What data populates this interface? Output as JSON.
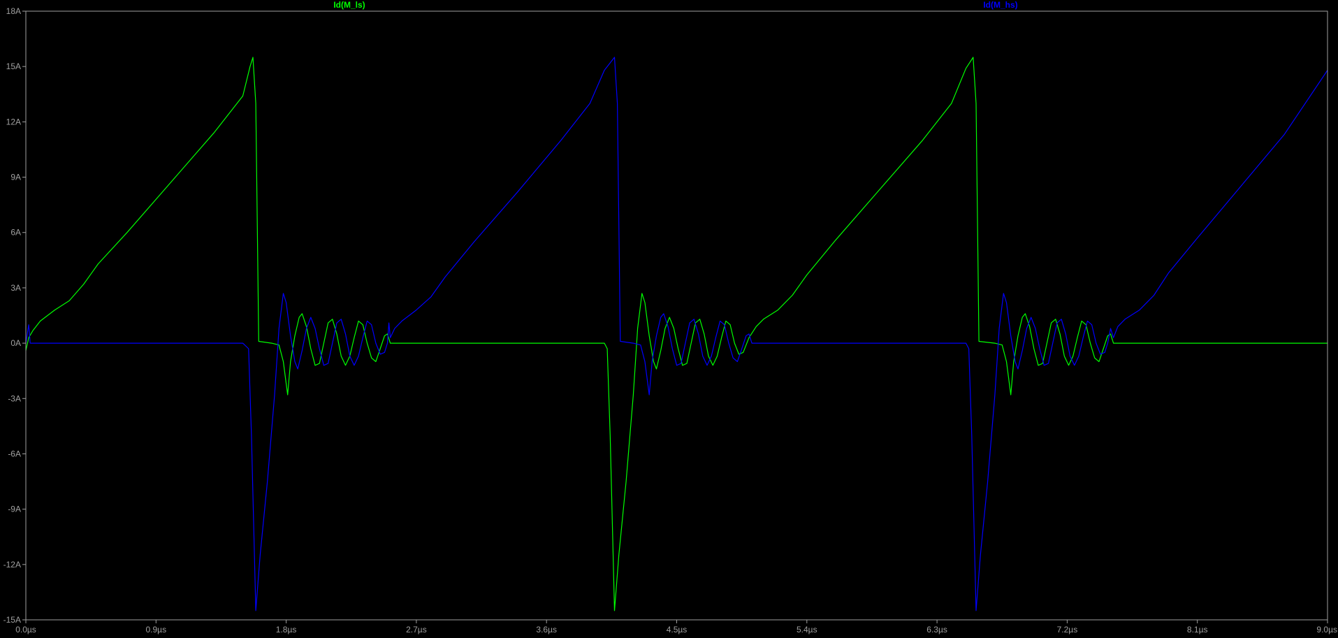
{
  "chart_data": {
    "type": "line",
    "xlabel": "",
    "ylabel": "",
    "xlim": [
      0,
      9.0
    ],
    "ylim": [
      -15,
      18
    ],
    "x_unit": "µs",
    "y_unit": "A",
    "x_ticks": [
      0.0,
      0.9,
      1.8,
      2.7,
      3.6,
      4.5,
      5.4,
      6.3,
      7.2,
      8.1,
      9.0
    ],
    "y_ticks": [
      -15,
      -12,
      -9,
      -6,
      -3,
      0,
      3,
      6,
      9,
      12,
      15,
      18
    ],
    "x_tick_labels": [
      "0.0µs",
      "0.9µs",
      "1.8µs",
      "2.7µs",
      "3.6µs",
      "4.5µs",
      "5.4µs",
      "6.3µs",
      "7.2µs",
      "8.1µs",
      "9.0µs"
    ],
    "y_tick_labels": [
      "-15A",
      "-12A",
      "-9A",
      "-6A",
      "-3A",
      "0A",
      "3A",
      "6A",
      "9A",
      "12A",
      "15A",
      "18A"
    ],
    "grid": false,
    "legend_position": "top",
    "background": "#000000",
    "axis_color": "#a0a0a0",
    "series": [
      {
        "name": "Id(M_ls)",
        "color": "#00ff00",
        "points": [
          [
            0.0,
            -0.4
          ],
          [
            0.02,
            0.3
          ],
          [
            0.05,
            0.7
          ],
          [
            0.1,
            1.2
          ],
          [
            0.2,
            1.8
          ],
          [
            0.3,
            2.3
          ],
          [
            0.4,
            3.2
          ],
          [
            0.5,
            4.3
          ],
          [
            0.7,
            6.0
          ],
          [
            1.0,
            8.7
          ],
          [
            1.3,
            11.4
          ],
          [
            1.5,
            13.4
          ],
          [
            1.55,
            15.0
          ],
          [
            1.57,
            15.5
          ],
          [
            1.59,
            13.0
          ],
          [
            1.61,
            0.1
          ],
          [
            1.7,
            0.0
          ],
          [
            1.75,
            -0.1
          ],
          [
            1.78,
            -1.0
          ],
          [
            1.81,
            -2.8
          ],
          [
            1.83,
            -1.0
          ],
          [
            1.86,
            0.4
          ],
          [
            1.89,
            1.4
          ],
          [
            1.91,
            1.6
          ],
          [
            1.94,
            0.9
          ],
          [
            1.97,
            -0.3
          ],
          [
            2.0,
            -1.2
          ],
          [
            2.03,
            -1.1
          ],
          [
            2.06,
            0.0
          ],
          [
            2.09,
            1.1
          ],
          [
            2.12,
            1.3
          ],
          [
            2.15,
            0.5
          ],
          [
            2.18,
            -0.7
          ],
          [
            2.21,
            -1.2
          ],
          [
            2.24,
            -0.7
          ],
          [
            2.27,
            0.3
          ],
          [
            2.3,
            1.2
          ],
          [
            2.33,
            1.0
          ],
          [
            2.36,
            0.0
          ],
          [
            2.39,
            -0.8
          ],
          [
            2.42,
            -1.0
          ],
          [
            2.45,
            -0.3
          ],
          [
            2.48,
            0.4
          ],
          [
            2.5,
            0.5
          ],
          [
            2.52,
            0.0
          ],
          [
            2.55,
            0.0
          ],
          [
            4.0,
            0.0
          ],
          [
            4.02,
            -0.3
          ],
          [
            4.04,
            -5.0
          ],
          [
            4.07,
            -14.5
          ],
          [
            4.1,
            -11.5
          ],
          [
            4.15,
            -7.5
          ],
          [
            4.2,
            -2.8
          ],
          [
            4.23,
            0.8
          ],
          [
            4.26,
            2.7
          ],
          [
            4.28,
            2.2
          ],
          [
            4.31,
            0.4
          ],
          [
            4.34,
            -1.0
          ],
          [
            4.36,
            -1.4
          ],
          [
            4.39,
            -0.4
          ],
          [
            4.42,
            0.8
          ],
          [
            4.45,
            1.4
          ],
          [
            4.48,
            0.8
          ],
          [
            4.51,
            -0.3
          ],
          [
            4.54,
            -1.2
          ],
          [
            4.57,
            -1.1
          ],
          [
            4.6,
            0.0
          ],
          [
            4.63,
            1.1
          ],
          [
            4.66,
            1.3
          ],
          [
            4.69,
            0.5
          ],
          [
            4.72,
            -0.7
          ],
          [
            4.75,
            -1.2
          ],
          [
            4.78,
            -0.7
          ],
          [
            4.81,
            0.3
          ],
          [
            4.84,
            1.2
          ],
          [
            4.87,
            1.0
          ],
          [
            4.9,
            0.0
          ],
          [
            4.93,
            -0.6
          ],
          [
            4.96,
            -0.5
          ],
          [
            5.0,
            0.3
          ],
          [
            5.05,
            0.9
          ],
          [
            5.1,
            1.3
          ],
          [
            5.2,
            1.8
          ],
          [
            5.3,
            2.6
          ],
          [
            5.4,
            3.7
          ],
          [
            5.6,
            5.6
          ],
          [
            5.9,
            8.3
          ],
          [
            6.2,
            11.0
          ],
          [
            6.4,
            13.0
          ],
          [
            6.5,
            14.9
          ],
          [
            6.55,
            15.5
          ],
          [
            6.57,
            13.0
          ],
          [
            6.59,
            0.1
          ],
          [
            6.7,
            0.0
          ],
          [
            6.75,
            -0.1
          ],
          [
            6.78,
            -1.0
          ],
          [
            6.81,
            -2.8
          ],
          [
            6.83,
            -1.0
          ],
          [
            6.86,
            0.4
          ],
          [
            6.89,
            1.4
          ],
          [
            6.91,
            1.6
          ],
          [
            6.94,
            0.9
          ],
          [
            6.97,
            -0.3
          ],
          [
            7.0,
            -1.2
          ],
          [
            7.03,
            -1.1
          ],
          [
            7.06,
            0.0
          ],
          [
            7.09,
            1.1
          ],
          [
            7.12,
            1.3
          ],
          [
            7.15,
            0.5
          ],
          [
            7.18,
            -0.7
          ],
          [
            7.21,
            -1.2
          ],
          [
            7.24,
            -0.7
          ],
          [
            7.27,
            0.3
          ],
          [
            7.3,
            1.2
          ],
          [
            7.33,
            1.0
          ],
          [
            7.36,
            0.0
          ],
          [
            7.39,
            -0.8
          ],
          [
            7.42,
            -1.0
          ],
          [
            7.45,
            -0.3
          ],
          [
            7.48,
            0.4
          ],
          [
            7.5,
            0.5
          ],
          [
            7.52,
            0.0
          ],
          [
            7.55,
            0.0
          ],
          [
            9.0,
            0.0
          ]
        ]
      },
      {
        "name": "Id(M_hs)",
        "color": "#0000ff",
        "points": [
          [
            0.0,
            0.0
          ],
          [
            0.02,
            1.0
          ],
          [
            0.03,
            0.0
          ],
          [
            1.5,
            0.0
          ],
          [
            1.54,
            -0.3
          ],
          [
            1.56,
            -5.0
          ],
          [
            1.59,
            -14.5
          ],
          [
            1.62,
            -11.5
          ],
          [
            1.67,
            -7.5
          ],
          [
            1.72,
            -2.8
          ],
          [
            1.75,
            0.8
          ],
          [
            1.78,
            2.7
          ],
          [
            1.8,
            2.2
          ],
          [
            1.83,
            0.4
          ],
          [
            1.86,
            -1.0
          ],
          [
            1.88,
            -1.4
          ],
          [
            1.91,
            -0.4
          ],
          [
            1.94,
            0.8
          ],
          [
            1.97,
            1.4
          ],
          [
            2.0,
            0.8
          ],
          [
            2.03,
            -0.3
          ],
          [
            2.06,
            -1.2
          ],
          [
            2.09,
            -1.1
          ],
          [
            2.12,
            0.0
          ],
          [
            2.15,
            1.1
          ],
          [
            2.18,
            1.3
          ],
          [
            2.21,
            0.5
          ],
          [
            2.24,
            -0.7
          ],
          [
            2.27,
            -1.2
          ],
          [
            2.3,
            -0.7
          ],
          [
            2.33,
            0.3
          ],
          [
            2.36,
            1.2
          ],
          [
            2.39,
            1.0
          ],
          [
            2.42,
            0.0
          ],
          [
            2.45,
            -0.6
          ],
          [
            2.48,
            -0.5
          ],
          [
            2.5,
            0.0
          ],
          [
            2.51,
            1.1
          ],
          [
            2.52,
            0.3
          ],
          [
            2.55,
            0.8
          ],
          [
            2.6,
            1.2
          ],
          [
            2.7,
            1.8
          ],
          [
            2.8,
            2.5
          ],
          [
            2.9,
            3.6
          ],
          [
            3.1,
            5.5
          ],
          [
            3.4,
            8.2
          ],
          [
            3.7,
            11.0
          ],
          [
            3.9,
            13.0
          ],
          [
            4.0,
            14.8
          ],
          [
            4.07,
            15.5
          ],
          [
            4.09,
            13.0
          ],
          [
            4.11,
            0.1
          ],
          [
            4.2,
            0.0
          ],
          [
            4.25,
            -0.1
          ],
          [
            4.28,
            -1.0
          ],
          [
            4.31,
            -2.8
          ],
          [
            4.33,
            -1.0
          ],
          [
            4.36,
            0.4
          ],
          [
            4.39,
            1.4
          ],
          [
            4.41,
            1.6
          ],
          [
            4.44,
            0.9
          ],
          [
            4.47,
            -0.3
          ],
          [
            4.5,
            -1.2
          ],
          [
            4.53,
            -1.1
          ],
          [
            4.56,
            0.0
          ],
          [
            4.59,
            1.1
          ],
          [
            4.62,
            1.3
          ],
          [
            4.65,
            0.5
          ],
          [
            4.68,
            -0.7
          ],
          [
            4.71,
            -1.2
          ],
          [
            4.74,
            -0.7
          ],
          [
            4.77,
            0.3
          ],
          [
            4.8,
            1.2
          ],
          [
            4.83,
            1.0
          ],
          [
            4.86,
            0.0
          ],
          [
            4.89,
            -0.8
          ],
          [
            4.92,
            -1.0
          ],
          [
            4.95,
            -0.3
          ],
          [
            4.98,
            0.4
          ],
          [
            5.0,
            0.5
          ],
          [
            5.02,
            0.0
          ],
          [
            5.05,
            0.0
          ],
          [
            6.5,
            0.0
          ],
          [
            6.52,
            -0.3
          ],
          [
            6.54,
            -5.0
          ],
          [
            6.57,
            -14.5
          ],
          [
            6.6,
            -11.5
          ],
          [
            6.65,
            -7.5
          ],
          [
            6.7,
            -2.8
          ],
          [
            6.73,
            0.8
          ],
          [
            6.76,
            2.7
          ],
          [
            6.78,
            2.2
          ],
          [
            6.81,
            0.4
          ],
          [
            6.84,
            -1.0
          ],
          [
            6.86,
            -1.4
          ],
          [
            6.89,
            -0.4
          ],
          [
            6.92,
            0.8
          ],
          [
            6.95,
            1.4
          ],
          [
            6.98,
            0.8
          ],
          [
            7.01,
            -0.3
          ],
          [
            7.04,
            -1.2
          ],
          [
            7.07,
            -1.1
          ],
          [
            7.1,
            0.0
          ],
          [
            7.13,
            1.1
          ],
          [
            7.16,
            1.3
          ],
          [
            7.19,
            0.5
          ],
          [
            7.22,
            -0.7
          ],
          [
            7.25,
            -1.2
          ],
          [
            7.28,
            -0.7
          ],
          [
            7.31,
            0.3
          ],
          [
            7.34,
            1.2
          ],
          [
            7.37,
            1.0
          ],
          [
            7.4,
            0.0
          ],
          [
            7.43,
            -0.6
          ],
          [
            7.46,
            -0.5
          ],
          [
            7.48,
            0.0
          ],
          [
            7.5,
            0.8
          ],
          [
            7.52,
            0.3
          ],
          [
            7.55,
            0.9
          ],
          [
            7.6,
            1.3
          ],
          [
            7.7,
            1.8
          ],
          [
            7.8,
            2.6
          ],
          [
            7.9,
            3.8
          ],
          [
            8.1,
            5.7
          ],
          [
            8.4,
            8.5
          ],
          [
            8.7,
            11.3
          ],
          [
            9.0,
            14.8
          ]
        ]
      }
    ]
  }
}
